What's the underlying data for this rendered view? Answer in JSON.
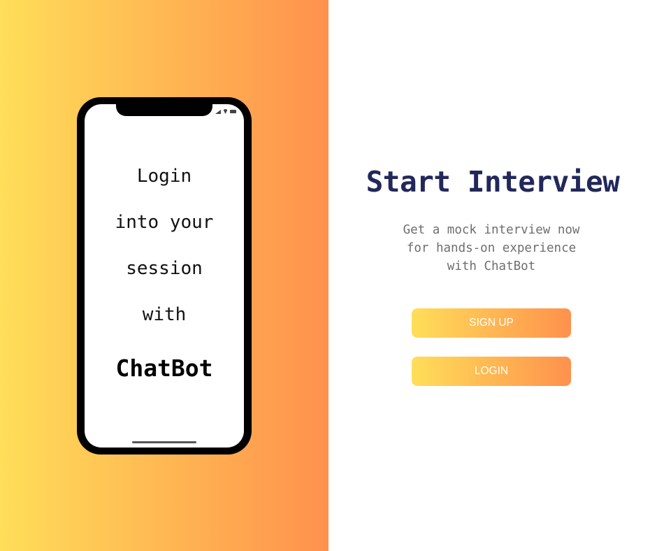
{
  "phone_screen": {
    "lines": [
      "Login",
      "into your",
      "session",
      "with"
    ],
    "brand": "ChatBot"
  },
  "main": {
    "title": "Start Interview",
    "subtitle_lines": [
      "Get a mock interview now",
      "for hands-on experience",
      "with ChatBot"
    ],
    "signup_label": "SIGN UP",
    "login_label": "LOGIN"
  },
  "colors": {
    "gradient_start": "#ffde59",
    "gradient_end": "#ff914d",
    "title": "#22285a",
    "subtitle": "#6e6e6e"
  },
  "icons": [
    "signal-icon",
    "wifi-icon",
    "battery-icon"
  ]
}
